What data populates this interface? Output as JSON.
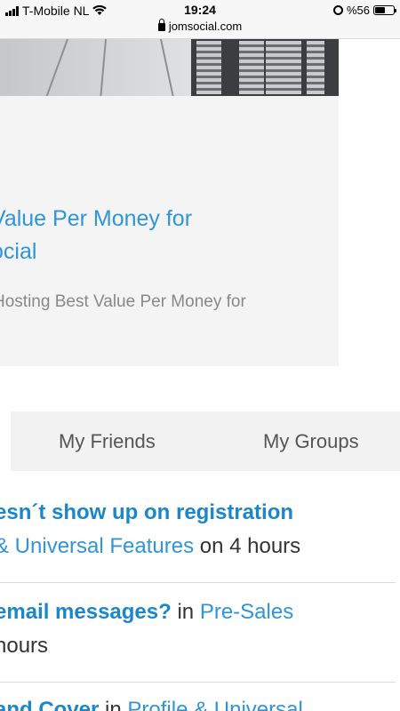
{
  "status_bar": {
    "carrier": "T-Mobile NL",
    "time": "19:24",
    "url": "jomsocial.com",
    "battery": "%56",
    "battery_level": 0.56
  },
  "card": {
    "title_line1": "Value Per Money for",
    "title_line2": "ocial",
    "description": "Hosting Best Value Per Money for"
  },
  "tabs": [
    {
      "label": "My Friends"
    },
    {
      "label": "My Groups"
    }
  ],
  "posts": [
    {
      "title": "esn´t show up on registration",
      "category": "& Universal Features",
      "time_text": " on 4 hours"
    },
    {
      "title": "email messages?",
      "in_text": " in ",
      "category": "Pre-Sales",
      "time_text": " hours"
    },
    {
      "title": "and Cover",
      "in_text": " in ",
      "category": "Profile & Universal"
    }
  ]
}
